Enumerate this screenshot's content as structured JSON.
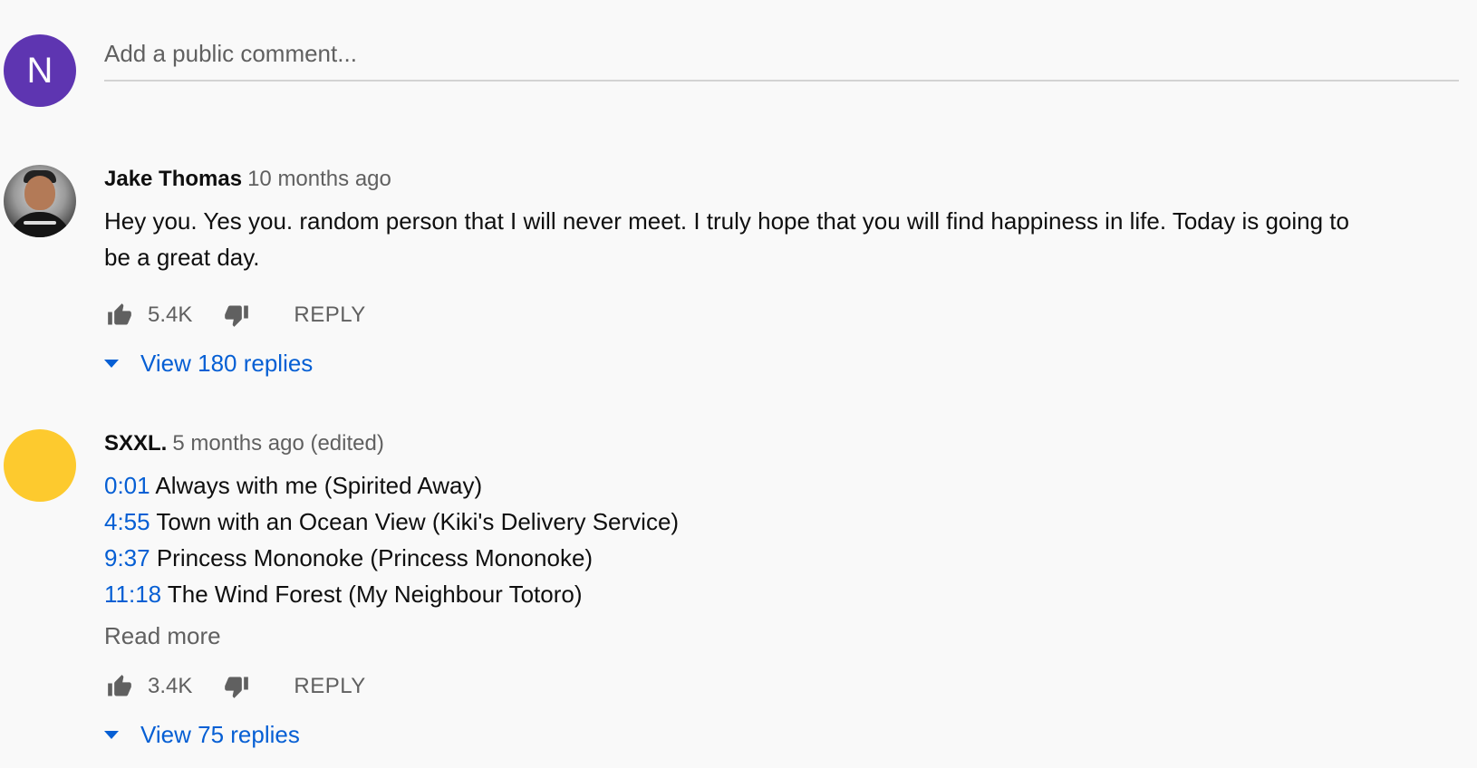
{
  "add_comment": {
    "avatar_letter": "N",
    "placeholder": "Add a public comment..."
  },
  "comments": [
    {
      "author": "Jake Thomas",
      "time": "10 months ago",
      "text": "Hey you. Yes you. random person that I will never meet. I truly hope that you will find happiness in life. Today is going to be a great day.",
      "likes": "5.4K",
      "reply_label": "REPLY",
      "view_replies": "View 180 replies"
    },
    {
      "author": "SXXL.",
      "time": "5 months ago (edited)",
      "tracks": [
        {
          "time": "0:01",
          "title": "Always with me (Spirited Away)"
        },
        {
          "time": "4:55",
          "title": "Town with an Ocean View (Kiki's Delivery Service)"
        },
        {
          "time": "9:37",
          "title": "Princess Mononoke (Princess Mononoke)"
        },
        {
          "time": "11:18",
          "title": "The Wind Forest (My Neighbour Totoro)"
        }
      ],
      "read_more": "Read more",
      "likes": "3.4K",
      "reply_label": "REPLY",
      "view_replies": "View 75 replies"
    }
  ],
  "colors": {
    "background": "#f9f9f9",
    "link_blue": "#065fd4",
    "avatar_purple": "#5e35b1",
    "avatar_yellow": "#fdca2e",
    "secondary_text": "#606060"
  },
  "icons": {
    "like": "thumbs-up-icon",
    "dislike": "thumbs-down-icon",
    "expand": "caret-down-icon"
  }
}
